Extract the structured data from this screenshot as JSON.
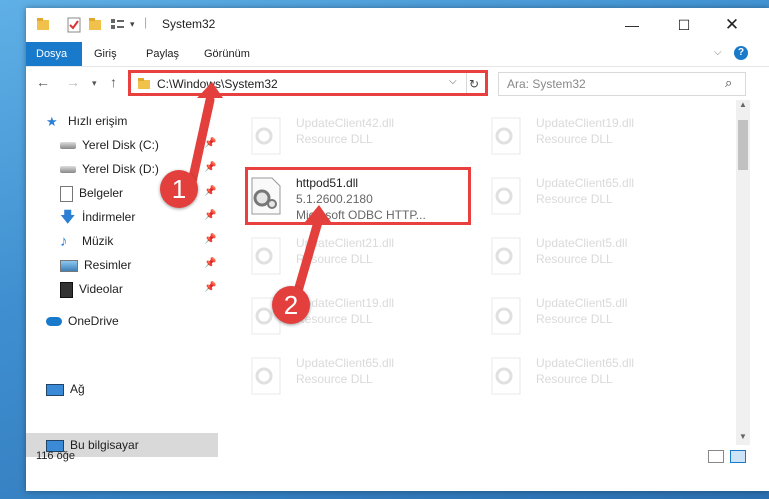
{
  "window": {
    "title": "System32"
  },
  "ribbon": {
    "tabs": [
      "Dosya",
      "Giriş",
      "Paylaş",
      "Görünüm"
    ]
  },
  "address": {
    "path": "C:\\Windows\\System32"
  },
  "search": {
    "placeholder": "Ara: System32"
  },
  "sidebar": {
    "items": [
      {
        "label": "Hızlı erişim",
        "icon": "star-icon"
      },
      {
        "label": "Yerel Disk (C:)",
        "icon": "drive-icon"
      },
      {
        "label": "Yerel Disk (D:)",
        "icon": "drive-icon"
      },
      {
        "label": "Belgeler",
        "icon": "documents-icon"
      },
      {
        "label": "İndirmeler",
        "icon": "download-icon"
      },
      {
        "label": "Müzik",
        "icon": "music-icon"
      },
      {
        "label": "Resimler",
        "icon": "pictures-icon"
      },
      {
        "label": "Videolar",
        "icon": "videos-icon"
      },
      {
        "label": "OneDrive",
        "icon": "cloud-icon"
      },
      {
        "label": "Bu bilgisayar",
        "icon": "computer-icon"
      },
      {
        "label": "Ağ",
        "icon": "network-icon"
      }
    ]
  },
  "files": {
    "highlight": {
      "name": "httpod51.dll",
      "version": "5.1.2600.2180",
      "desc": "Microsoft ODBC HTTP..."
    },
    "ghosts": [
      {
        "name": "UpdateClient42.dll",
        "type": "Resource DLL"
      },
      {
        "name": "UpdateClient19.dll",
        "type": "Resource DLL"
      },
      {
        "name": "UpdateClient65.dll",
        "type": "Resource DLL"
      },
      {
        "name": "UpdateClient21.dll",
        "type": "Resource DLL"
      },
      {
        "name": "UpdateClient5.dll",
        "type": "Resource DLL"
      },
      {
        "name": "UpdateClient19.dll",
        "type": "Resource DLL"
      },
      {
        "name": "UpdateClient5.dll",
        "type": "Resource DLL"
      },
      {
        "name": "UpdateClient65.dll",
        "type": "Resource DLL"
      },
      {
        "name": "UpdateClient65.dll",
        "type": "Resource DLL"
      }
    ]
  },
  "status": {
    "count": "116 öğe"
  },
  "callouts": [
    "1",
    "2"
  ],
  "colors": {
    "accent": "#1979ca",
    "callout": "#e3403d"
  }
}
